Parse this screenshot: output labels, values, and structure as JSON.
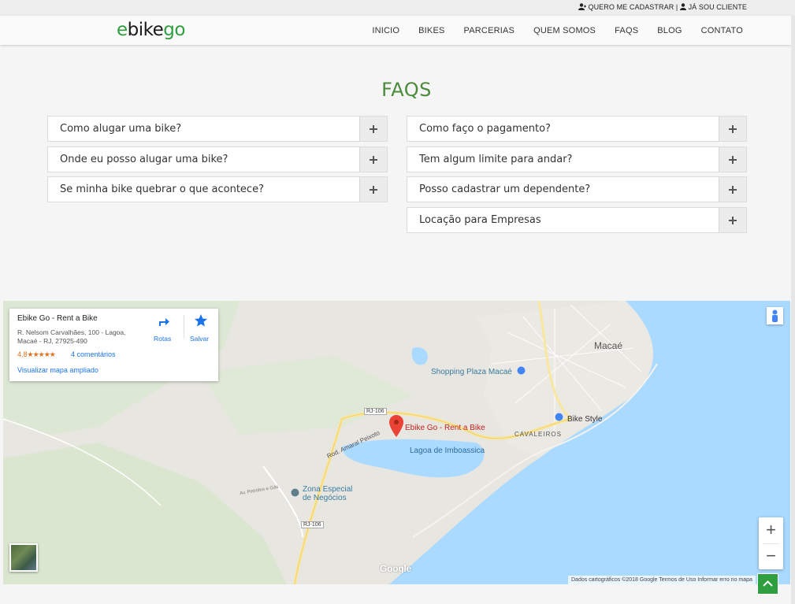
{
  "header": {
    "register_link": "QUERO ME CADASTRAR",
    "separator": "|",
    "client_link": "JÁ SOU CLIENTE",
    "logo": {
      "part1": "e",
      "part2": "bike",
      "part3": "go"
    },
    "menu": [
      "INICIO",
      "BIKES",
      "PARCERIAS",
      "QUEM SOMOS",
      "FAQS",
      "BLOG",
      "CONTATO"
    ]
  },
  "faq": {
    "title": "FAQS",
    "left": [
      "Como alugar uma bike?",
      "Onde eu posso alugar uma bike?",
      "Se minha bike quebrar o que acontece?"
    ],
    "right": [
      "Como faço o pagamento?",
      "Tem algum limite para andar?",
      "Posso cadastrar um dependente?",
      "Locação para Empresas"
    ]
  },
  "map": {
    "place_name": "Ebike Go - Rent a Bike",
    "address_line1": "R. Nelsom Carvalhães, 100 - Lagoa,",
    "address_line2": "Macaé - RJ, 27925-490",
    "rating": "4,8",
    "stars": "★★★★★",
    "reviews": "4 comentários",
    "view_larger": "Visualizar mapa ampliado",
    "directions": "Rotas",
    "save": "Salvar",
    "labels": {
      "macae": "Macaé",
      "shopping": "Shopping Plaza Macaé",
      "bike_style": "Bike Style",
      "cavaleiros": "CAVALEIROS",
      "lagoa": "Lagoa de Imboassica",
      "pin": "Ebike Go - Rent a Bike",
      "rj106_top": "RJ-106",
      "rj106_bottom": "RJ-106",
      "rod_amaral": "Rod. Amaral Peixoto",
      "zona1": "Zona Especial",
      "zona2": "de Negócios",
      "petroleo": "Av. Petróleo e Gás",
      "google": "Google"
    },
    "attribution": "Dados cartográficos ©2018 Google   Termos de Uso   Informar erro no mapa",
    "zoom_in": "+",
    "zoom_out": "−"
  },
  "colors": {
    "brand": "#2e9e3f",
    "water": "#aadaff",
    "land": "#e7e5df"
  }
}
